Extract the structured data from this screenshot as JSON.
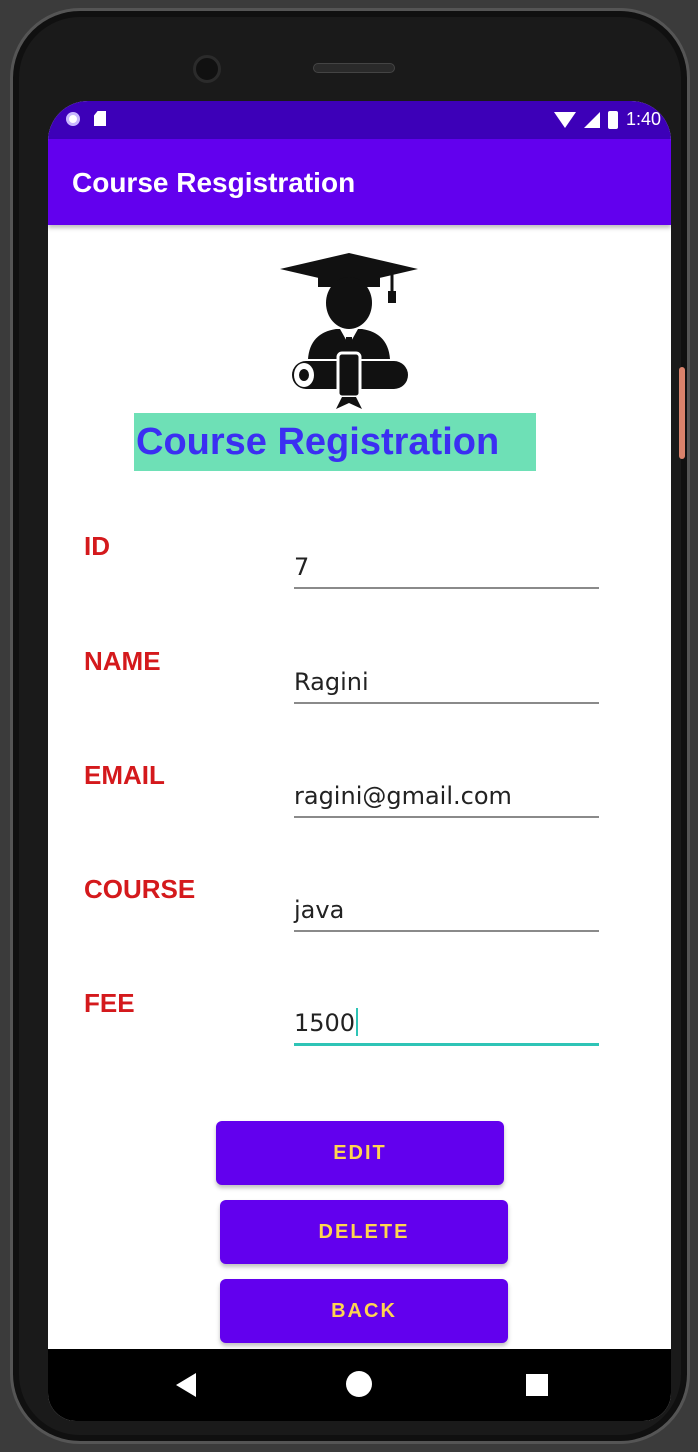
{
  "status_bar": {
    "time": "1:40",
    "icons": [
      "notification-dot-icon",
      "sd-card-icon",
      "wifi-icon",
      "signal-icon",
      "battery-icon"
    ]
  },
  "app_bar": {
    "title": "Course Resgistration"
  },
  "logo": {
    "icon": "graduate-icon"
  },
  "banner": {
    "text": "Course Registration"
  },
  "form": {
    "fields": [
      {
        "label": "ID",
        "value": "7"
      },
      {
        "label": "NAME",
        "value": "Ragini"
      },
      {
        "label": "EMAIL",
        "value": "ragini@gmail.com"
      },
      {
        "label": "COURSE",
        "value": "java"
      },
      {
        "label": "FEE",
        "value": "1500"
      }
    ]
  },
  "buttons": {
    "edit": "EDIT",
    "delete": "DELETE",
    "back": "BACK"
  },
  "nav_bar": {
    "icons": [
      "back-icon",
      "home-icon",
      "recents-icon"
    ]
  },
  "colors": {
    "status_bar": "#3d00b8",
    "app_bar": "#6200ee",
    "label": "#d4191c",
    "banner_bg": "#6ee0b6",
    "banner_text": "#3b2ff2",
    "button_text": "#ffd54f",
    "focus_underline": "#2ec4b6"
  }
}
